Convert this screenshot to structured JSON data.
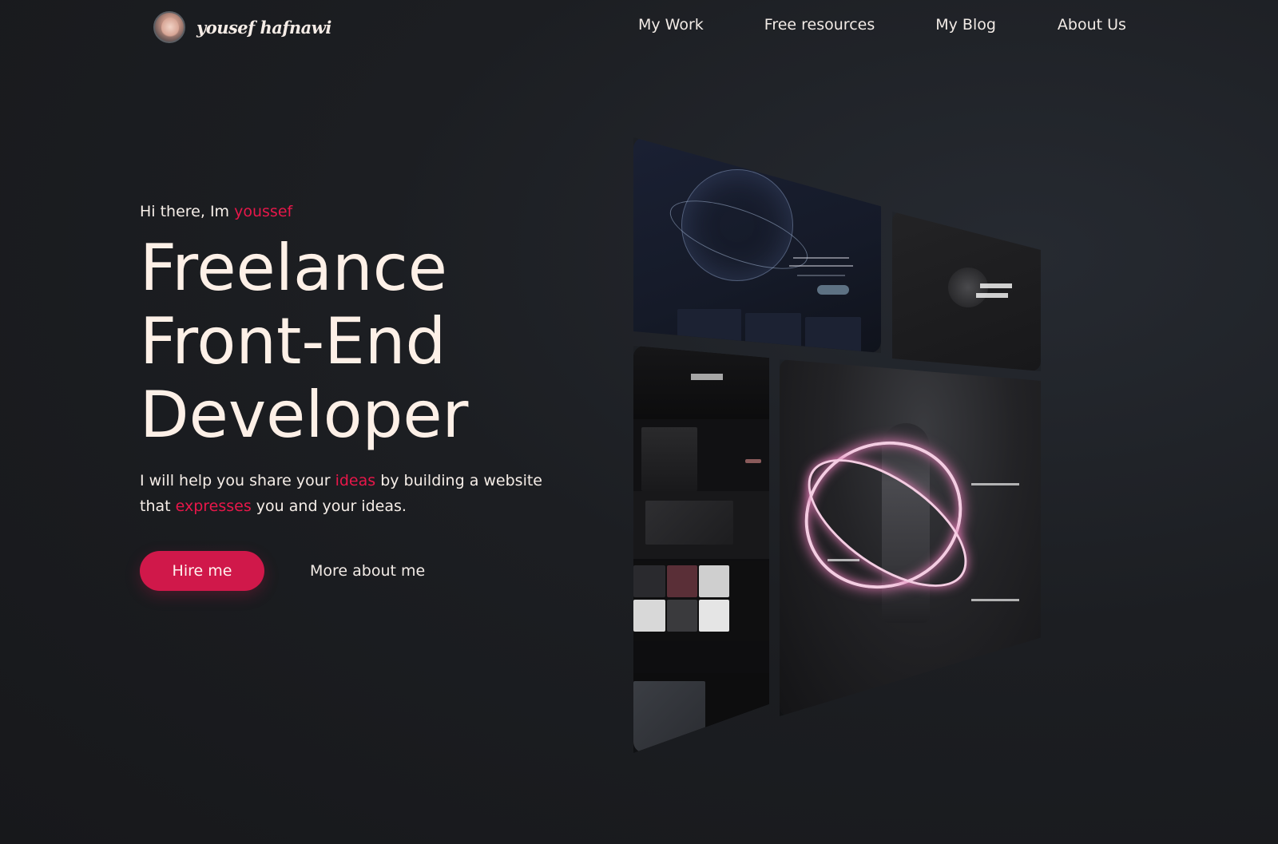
{
  "header": {
    "brand_name": "yousef hafnawi",
    "nav": [
      "My Work",
      "Free resources",
      "My Blog",
      "About Us"
    ]
  },
  "hero": {
    "greeting_prefix": "Hi there, Im ",
    "greeting_name": "youssef",
    "title_lines": [
      "Freelance",
      "Front-End",
      "Developer"
    ],
    "desc_part1": "I will help you share your ",
    "desc_accent1": "ideas",
    "desc_part2": " by building a website that ",
    "desc_accent2": "expresses",
    "desc_part3": " you and your ideas.",
    "hire_label": "Hire me",
    "more_label": "More about me"
  },
  "colors": {
    "accent": "#e8174a",
    "button": "#d0184a",
    "background": "#1c1e22",
    "text": "#fdf0e7"
  },
  "showcase": {
    "cards": [
      "ai-site-preview",
      "design-studio-preview",
      "mobile-portfolio-preview",
      "space-landing-preview"
    ]
  }
}
